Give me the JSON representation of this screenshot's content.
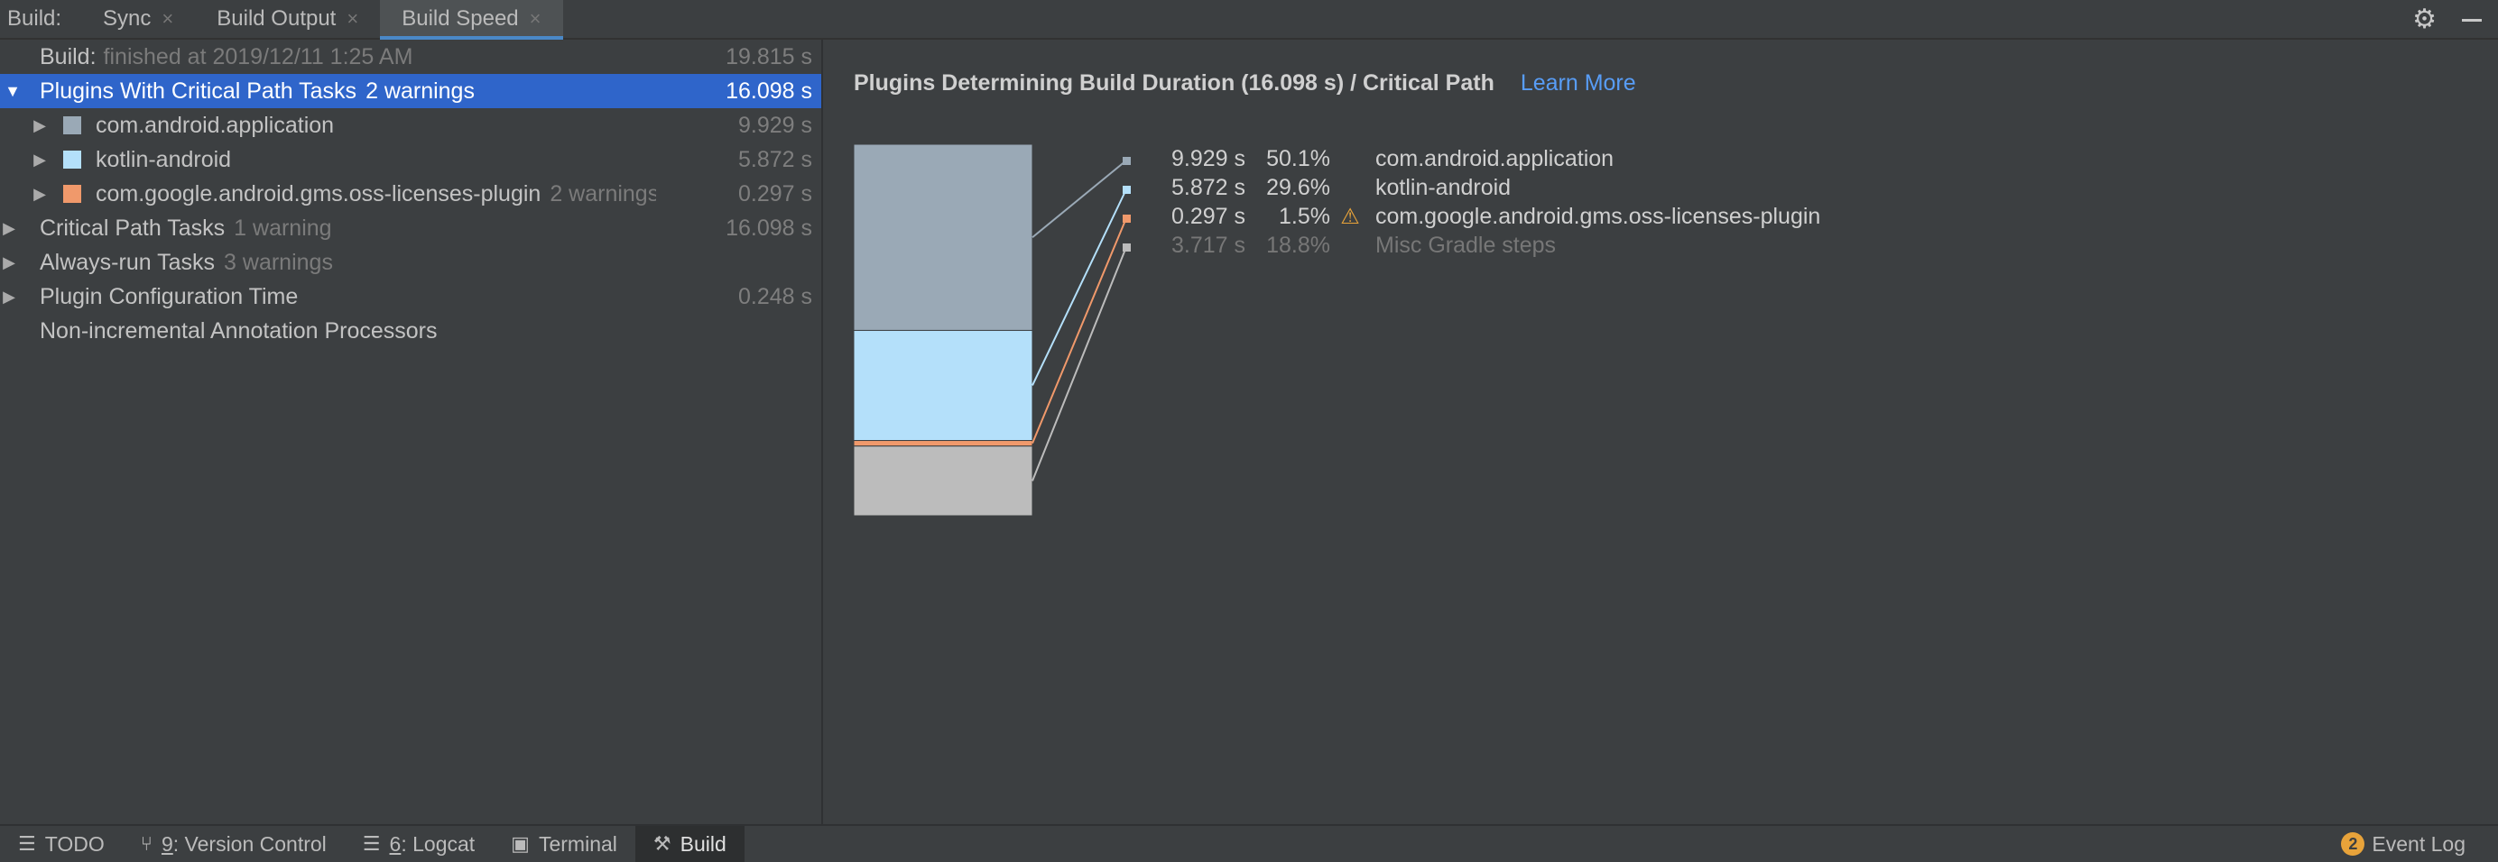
{
  "topbar": {
    "prefix": "Build:",
    "tabs": [
      {
        "label": "Sync",
        "close": "×"
      },
      {
        "label": "Build Output",
        "close": "×"
      },
      {
        "label": "Build Speed",
        "close": "×"
      }
    ]
  },
  "tree": {
    "rows": [
      {
        "label": "Build:",
        "muted": "finished at 2019/12/11 1:25 AM",
        "value": "19.815 s"
      },
      {
        "label": "Plugins With Critical Path Tasks",
        "muted": "2 warnings",
        "value": "16.098 s"
      },
      {
        "label": "com.android.application",
        "muted": "",
        "value": "9.929 s",
        "color": "#9aa9b6"
      },
      {
        "label": "kotlin-android",
        "muted": "",
        "value": "5.872 s",
        "color": "#b4e0fa"
      },
      {
        "label": "com.google.android.gms.oss-licenses-plugin",
        "muted": "2 warnings",
        "value": "0.297 s",
        "color": "#f0996b"
      },
      {
        "label": "Critical Path Tasks",
        "muted": "1 warning",
        "value": "16.098 s"
      },
      {
        "label": "Always-run Tasks",
        "muted": "3 warnings",
        "value": ""
      },
      {
        "label": "Plugin Configuration Time",
        "muted": "",
        "value": "0.248 s"
      },
      {
        "label": "Non-incremental Annotation Processors",
        "muted": "",
        "value": ""
      }
    ]
  },
  "panel": {
    "title": "Plugins Determining Build Duration (16.098 s) / Critical Path",
    "link": "Learn More"
  },
  "chart_data": {
    "type": "bar",
    "orientation": "stacked-vertical",
    "unit": "s",
    "items": [
      {
        "name": "com.android.application",
        "value": 9.929,
        "value_label": "9.929 s",
        "percent": 50.1,
        "percent_label": "50.1%",
        "color": "#9aa9b6",
        "warning": false
      },
      {
        "name": "kotlin-android",
        "value": 5.872,
        "value_label": "5.872 s",
        "percent": 29.6,
        "percent_label": "29.6%",
        "color": "#b4e0fa",
        "warning": false
      },
      {
        "name": "com.google.android.gms.oss-licenses-plugin",
        "value": 0.297,
        "value_label": "0.297 s",
        "percent": 1.5,
        "percent_label": "1.5%",
        "color": "#f0996b",
        "warning": true
      },
      {
        "name": "Misc Gradle steps",
        "value": 3.717,
        "value_label": "3.717 s",
        "percent": 18.8,
        "percent_label": "18.8%",
        "color": "#bcbcbc",
        "warning": false,
        "dim": true
      }
    ],
    "warning_glyph": "⚠"
  },
  "bottombar": {
    "tools": [
      {
        "icon": "☰",
        "label": "TODO",
        "key": ""
      },
      {
        "icon": "⑂",
        "label": ": Version Control",
        "key": "9"
      },
      {
        "icon": "☰",
        "label": ": Logcat",
        "key": "6"
      },
      {
        "icon": "▣",
        "label": "Terminal",
        "key": ""
      },
      {
        "icon": "⚒",
        "label": "Build",
        "key": ""
      }
    ],
    "event_log": {
      "count": "2",
      "label": "Event Log"
    }
  },
  "icons": {
    "gear": "⚙",
    "arrow_right": "▶",
    "arrow_down": "▼"
  }
}
